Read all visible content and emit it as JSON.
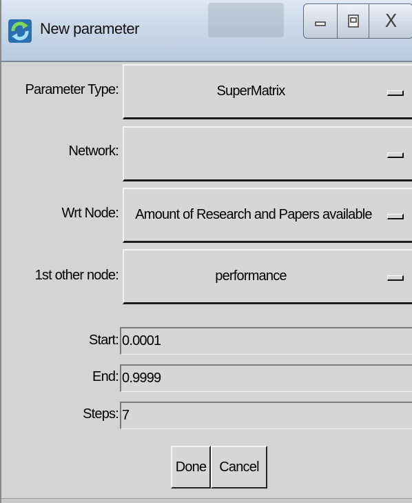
{
  "window": {
    "title": "New parameter",
    "icon": "refresh-app-icon",
    "controls": {
      "minimize": "minimize-icon",
      "maximize": "maximize-icon",
      "close": "X"
    }
  },
  "form": {
    "parameter_type": {
      "label": "Parameter Type:",
      "value": "SuperMatrix"
    },
    "network": {
      "label": "Network:",
      "value": ""
    },
    "wrt_node": {
      "label": "Wrt Node:",
      "value": "Amount of Research and Papers available"
    },
    "other_node": {
      "label": "1st other node:",
      "value": "performance"
    },
    "start": {
      "label": "Start:",
      "value": "0.0001"
    },
    "end": {
      "label": "End:",
      "value": "0.9999"
    },
    "steps": {
      "label": "Steps:",
      "value": "7"
    }
  },
  "buttons": {
    "done": "Done",
    "cancel": "Cancel"
  },
  "colors": {
    "window_bg": "#d4d4d4",
    "titlebar_top": "#dfe8f3",
    "titlebar_bottom": "#b9cadf"
  }
}
